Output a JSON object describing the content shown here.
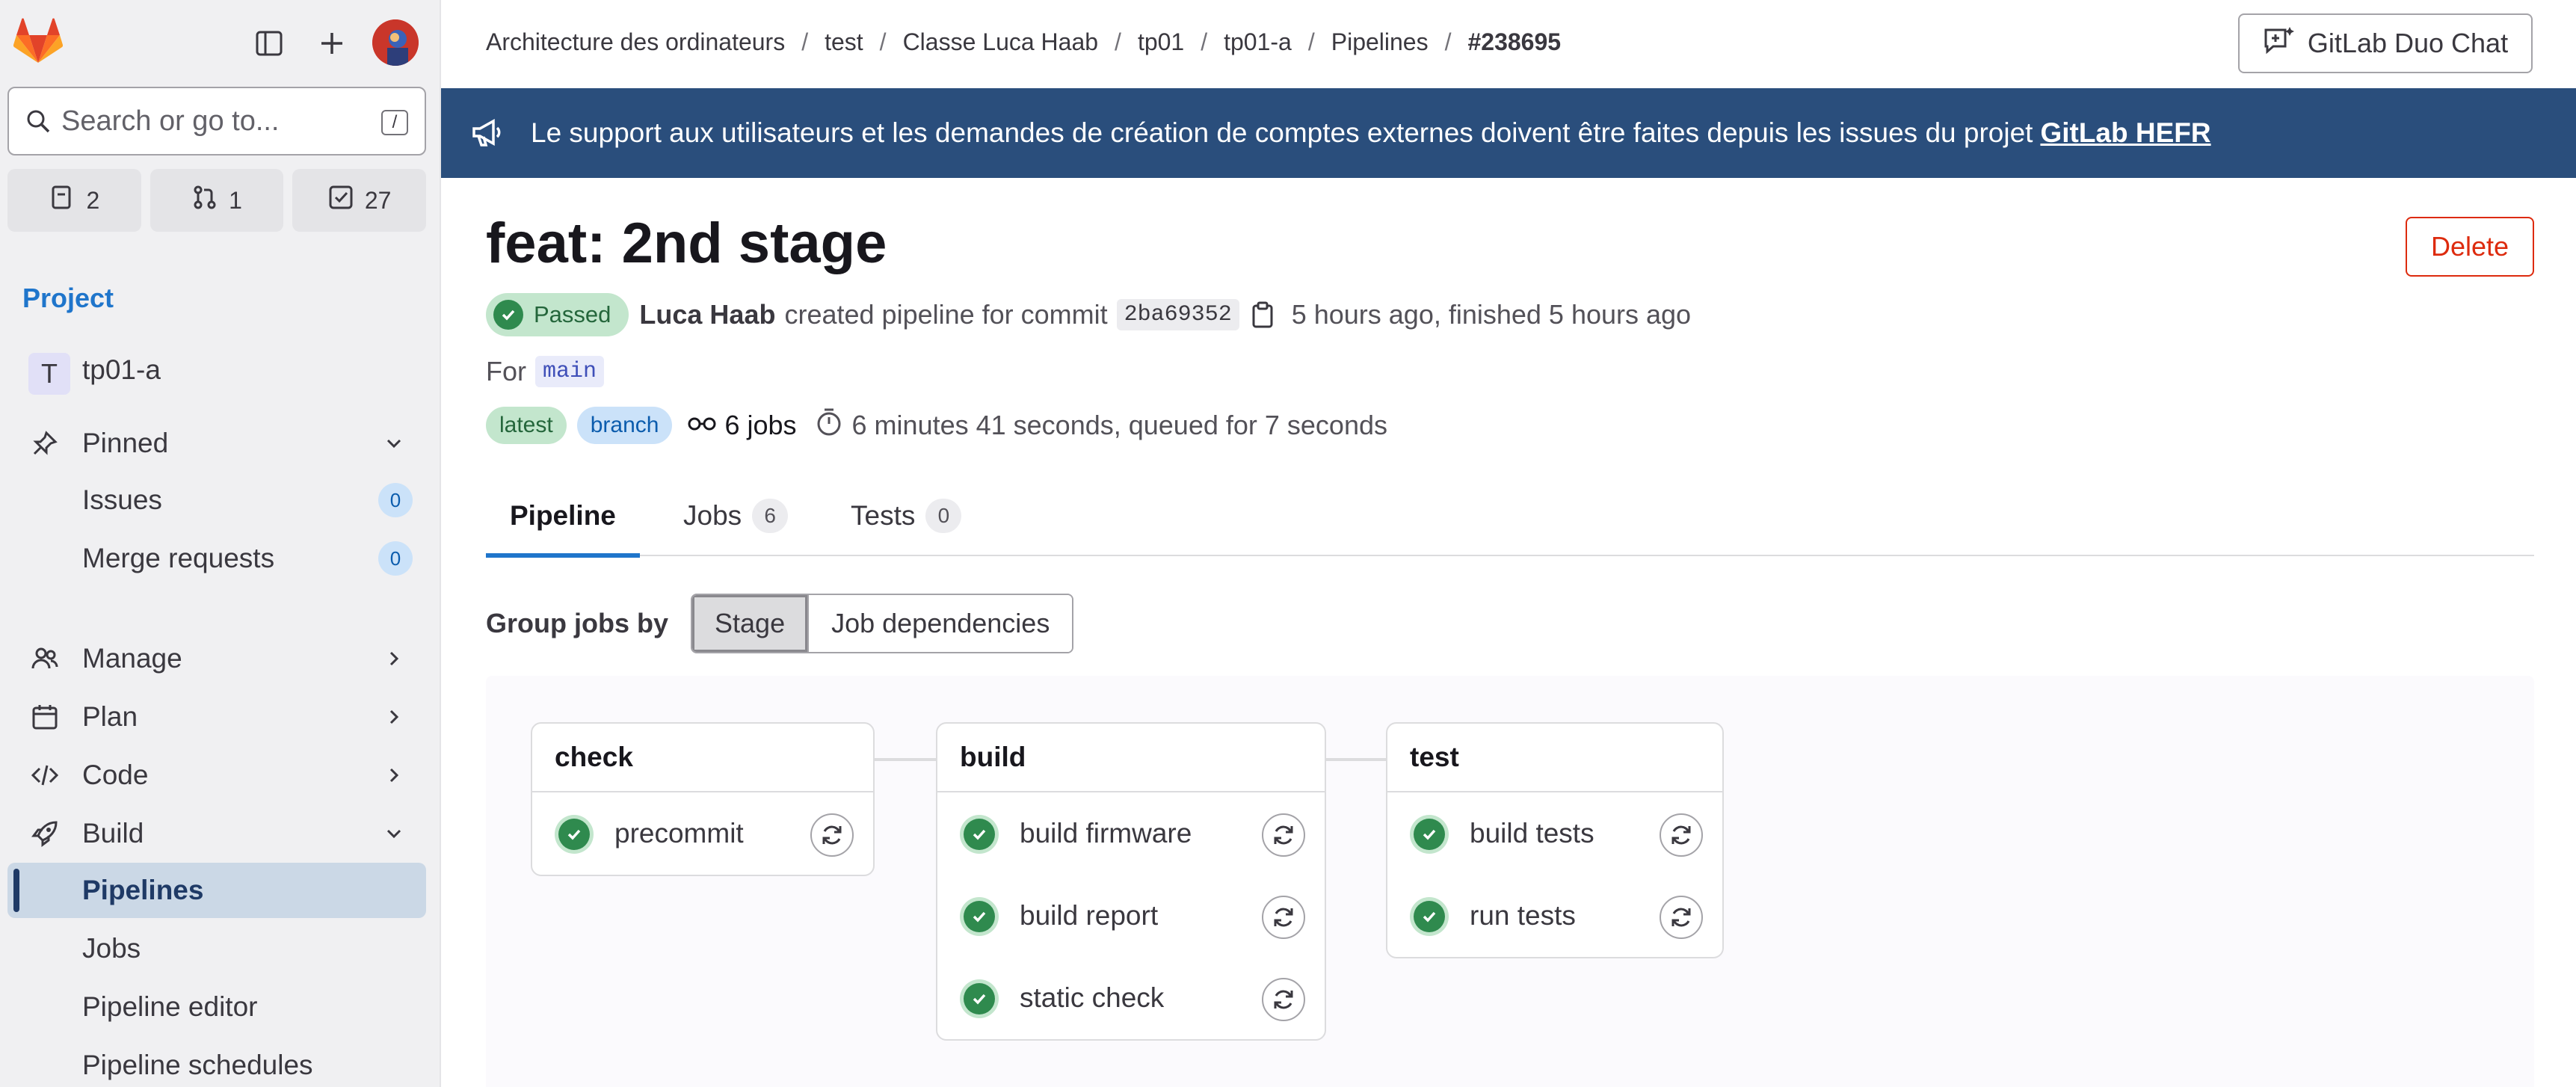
{
  "sidebar": {
    "search_placeholder": "Search or go to...",
    "search_shortcut": "/",
    "counts": {
      "issues": "2",
      "merge_requests": "1",
      "todos": "27"
    },
    "section_title": "Project",
    "project_initial": "T",
    "project_name": "tp01-a",
    "pinned_label": "Pinned",
    "pinned_items": [
      {
        "label": "Issues",
        "count": "0"
      },
      {
        "label": "Merge requests",
        "count": "0"
      }
    ],
    "nav_items": [
      {
        "label": "Manage"
      },
      {
        "label": "Plan"
      },
      {
        "label": "Code"
      },
      {
        "label": "Build"
      }
    ],
    "build_sub_items": [
      {
        "label": "Pipelines"
      },
      {
        "label": "Jobs"
      },
      {
        "label": "Pipeline editor"
      },
      {
        "label": "Pipeline schedules"
      }
    ]
  },
  "breadcrumbs": [
    "Architecture des ordinateurs",
    "test",
    "Classe Luca Haab",
    "tp01",
    "tp01-a",
    "Pipelines",
    "#238695"
  ],
  "duo_chat_label": "GitLab Duo Chat",
  "banner": {
    "text": "Le support aux utilisateurs et les demandes de création de comptes externes doivent être faites depuis les issues du projet",
    "link": "GitLab HEFR"
  },
  "pipeline": {
    "title": "feat: 2nd stage",
    "delete_label": "Delete",
    "status": "Passed",
    "author": "Luca Haab",
    "created_text": "created pipeline for commit",
    "sha": "2ba69352",
    "time_text": "5 hours ago, finished 5 hours ago",
    "for_label": "For",
    "branch": "main",
    "tags": [
      "latest",
      "branch"
    ],
    "jobs_count": "6 jobs",
    "duration": "6 minutes 41 seconds, queued for 7 seconds"
  },
  "tabs": [
    {
      "label": "Pipeline",
      "count": ""
    },
    {
      "label": "Jobs",
      "count": "6"
    },
    {
      "label": "Tests",
      "count": "0"
    }
  ],
  "group_by": {
    "label": "Group jobs by",
    "options": [
      "Stage",
      "Job dependencies"
    ],
    "selected": "Stage"
  },
  "stages": [
    {
      "name": "check",
      "jobs": [
        "precommit"
      ]
    },
    {
      "name": "build",
      "jobs": [
        "build firmware",
        "build report",
        "static check"
      ]
    },
    {
      "name": "test",
      "jobs": [
        "build tests",
        "run tests"
      ]
    }
  ],
  "colors": {
    "brand": "#e24329",
    "accent": "#1f75cb",
    "banner": "#2a4e7c",
    "success": "#2f8a4e",
    "danger": "#dd2b0e"
  }
}
